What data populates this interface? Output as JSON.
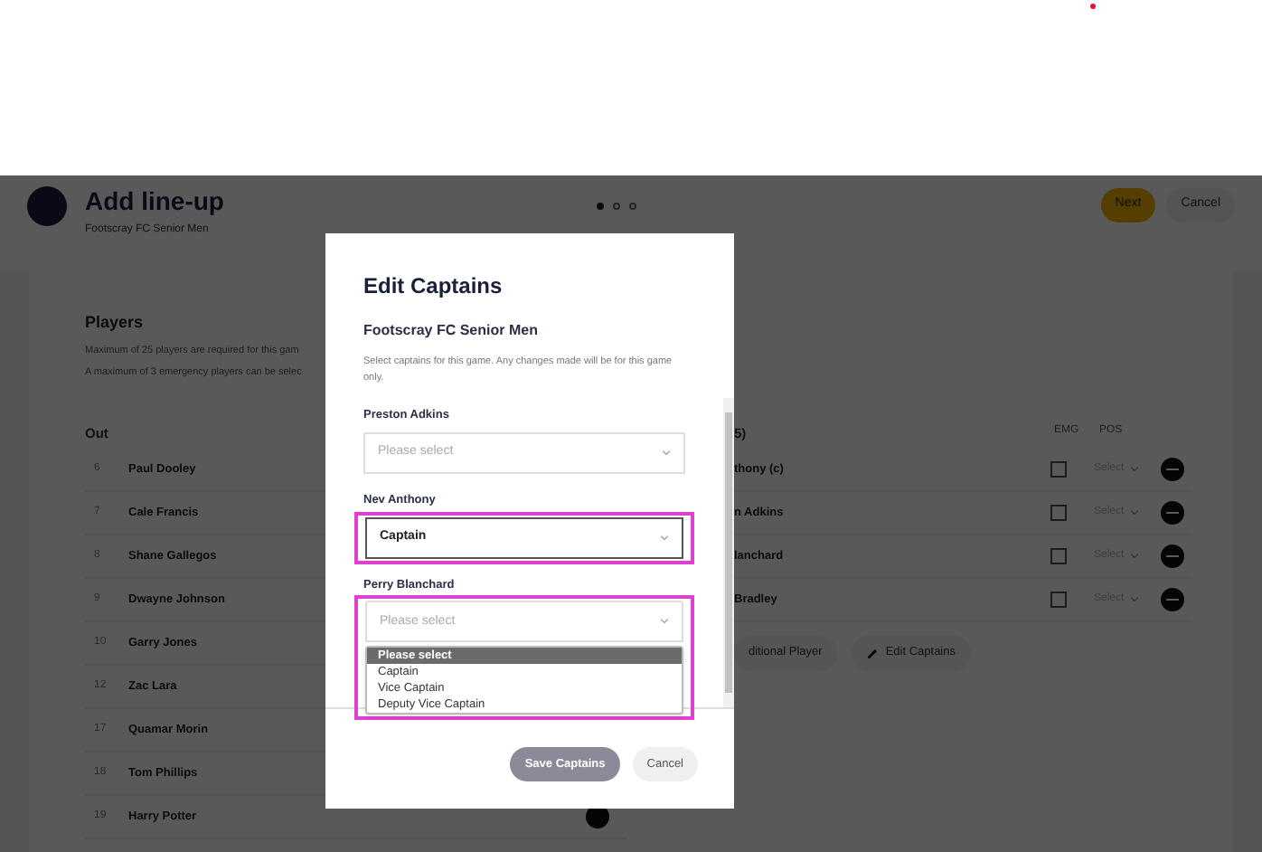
{
  "header": {
    "title": "Add line-up",
    "subtitle": "Footscray FC Senior Men",
    "steps": [
      {
        "selected": true
      },
      {
        "selected": false
      },
      {
        "selected": false
      }
    ],
    "buttons": [
      {
        "label": "Next",
        "kind": "primary"
      },
      {
        "label": "Cancel",
        "kind": "secondary"
      }
    ]
  },
  "players": {
    "title": "Players",
    "notes": [
      "Maximum of 25 players are required for this gam",
      "A maximum of 3 emergency players can be selec"
    ]
  },
  "out_table": {
    "heading": "Out",
    "rows": [
      {
        "number": "6",
        "name": "Paul Dooley"
      },
      {
        "number": "7",
        "name": "Cale Francis"
      },
      {
        "number": "8",
        "name": "Shane Gallegos"
      },
      {
        "number": "9",
        "name": "Dwayne Johnson"
      },
      {
        "number": "10",
        "name": "Garry Jones"
      },
      {
        "number": "12",
        "name": "Zac Lara"
      },
      {
        "number": "17",
        "name": "Quamar Morin"
      },
      {
        "number": "18",
        "name": "Tom Phillips"
      },
      {
        "number": "19",
        "name": "Harry Potter"
      }
    ]
  },
  "in_table": {
    "heading": "5)",
    "columns": [
      "EMG",
      "POS"
    ],
    "rows": [
      {
        "name": "thony (c)",
        "emg_checked": false,
        "pos": "Select"
      },
      {
        "name": "n Adkins",
        "emg_checked": false,
        "pos": "Select"
      },
      {
        "name": "lanchard",
        "emg_checked": false,
        "pos": "Select"
      },
      {
        "name": "Bradley",
        "emg_checked": false,
        "pos": "Select"
      }
    ],
    "buttons": [
      {
        "label": "ditional Player",
        "kind": "add"
      },
      {
        "label": "Edit Captains",
        "kind": "edit"
      }
    ]
  },
  "modal": {
    "title": "Edit Captains",
    "team": "Footscray FC Senior Men",
    "description": "Select captains for this game. Any changes made will be for this game only.",
    "fields": [
      {
        "label": "Preston Adkins",
        "placeholder": "Please select",
        "highlighted": false,
        "expanded": false
      },
      {
        "label": "Nev Anthony",
        "value": "Captain",
        "highlighted": true,
        "expanded": false
      },
      {
        "label": "Perry Blanchard",
        "placeholder": "Please select",
        "highlighted": true,
        "expanded": true,
        "options": [
          {
            "label": "Please select",
            "selected": true
          },
          {
            "label": "Captain",
            "selected": false
          },
          {
            "label": "Vice Captain",
            "selected": false
          },
          {
            "label": "Deputy Vice Captain",
            "selected": false
          }
        ]
      }
    ],
    "buttons": [
      {
        "label": "Save Captains",
        "kind": "primary"
      },
      {
        "label": "Cancel",
        "kind": "secondary"
      }
    ]
  }
}
